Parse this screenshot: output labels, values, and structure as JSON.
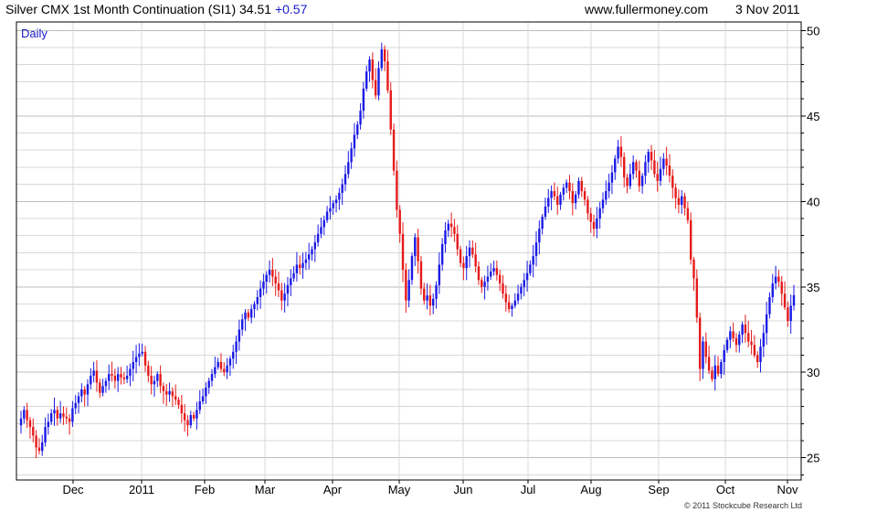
{
  "header": {
    "title": "Silver CMX 1st Month Continuation (SI1)",
    "last": "34.51",
    "change": "+0.57",
    "site": "www.fullermoney.com",
    "date": "3 Nov 2011"
  },
  "copyright": "© 2011 Stockcube Research Ltd",
  "chart_data": {
    "type": "candlestick",
    "period_label": "Daily",
    "x_tick_labels": [
      "Dec",
      "2011",
      "Feb",
      "Mar",
      "Apr",
      "May",
      "Jun",
      "Jul",
      "Aug",
      "Sep",
      "Oct",
      "Nov"
    ],
    "y_ticks": [
      25,
      30,
      35,
      40,
      45,
      50
    ],
    "ylim": [
      23.7,
      50.5
    ],
    "y_axis_side": "right",
    "grid": true,
    "colors": {
      "up": "#1a1ae6",
      "down": "#e61a1a",
      "grid": "#d8d8d8",
      "frame": "#000000",
      "label": "#1a1ac8"
    },
    "series_close": [
      27.3,
      27.8,
      27.2,
      26.8,
      26.3,
      25.6,
      25.4,
      25.9,
      26.8,
      27.1,
      27.6,
      27.8,
      27.3,
      27.6,
      27.4,
      27.3,
      27.1,
      27.9,
      28.2,
      28.6,
      29.0,
      28.7,
      29.3,
      29.8,
      30.1,
      29.4,
      28.8,
      29.2,
      29.5,
      29.9,
      29.8,
      29.5,
      29.9,
      29.7,
      29.6,
      29.8,
      30.2,
      30.6,
      30.9,
      31.1,
      31.2,
      30.4,
      29.8,
      29.3,
      29.5,
      29.9,
      29.2,
      28.9,
      28.7,
      28.9,
      28.6,
      28.4,
      28.1,
      27.6,
      27.2,
      26.9,
      27.5,
      27.3,
      27.8,
      28.3,
      28.6,
      29.1,
      29.5,
      29.9,
      30.3,
      30.6,
      30.2,
      30.0,
      30.4,
      30.8,
      31.2,
      31.8,
      32.5,
      33.1,
      33.5,
      33.2,
      33.7,
      34.0,
      34.4,
      34.9,
      35.3,
      35.7,
      36.0,
      35.6,
      35.2,
      34.8,
      34.2,
      34.6,
      35.1,
      35.5,
      35.8,
      36.3,
      36.1,
      36.4,
      36.6,
      36.9,
      37.2,
      37.6,
      38.1,
      38.5,
      38.9,
      39.4,
      39.6,
      39.9,
      40.1,
      40.5,
      41.0,
      41.6,
      42.3,
      43.1,
      43.9,
      44.5,
      45.3,
      46.6,
      47.6,
      48.3,
      47.1,
      46.2,
      47.8,
      48.9,
      48.2,
      46.5,
      44.2,
      41.8,
      39.5,
      38.1,
      36.0,
      34.2,
      35.4,
      36.8,
      37.9,
      36.5,
      34.9,
      34.2,
      34.5,
      33.9,
      34.3,
      35.1,
      36.3,
      37.5,
      38.3,
      38.7,
      38.5,
      38.1,
      37.2,
      36.4,
      36.1,
      36.8,
      37.3,
      36.9,
      36.2,
      35.4,
      35.0,
      35.3,
      35.6,
      35.9,
      36.1,
      35.7,
      35.2,
      34.6,
      34.1,
      33.7,
      33.9,
      34.2,
      34.6,
      35.0,
      35.4,
      35.8,
      36.3,
      36.8,
      37.6,
      38.4,
      39.1,
      39.7,
      40.2,
      40.6,
      40.3,
      39.8,
      40.4,
      40.8,
      41.1,
      40.6,
      39.9,
      40.4,
      41.2,
      40.6,
      40.1,
      39.3,
      38.8,
      38.4,
      39.0,
      39.6,
      40.1,
      40.6,
      41.1,
      41.7,
      42.5,
      43.2,
      42.6,
      41.4,
      40.9,
      41.6,
      42.3,
      41.8,
      40.9,
      41.5,
      42.3,
      42.9,
      42.4,
      41.6,
      41.2,
      41.9,
      42.5,
      42.1,
      41.5,
      40.8,
      40.2,
      39.8,
      40.3,
      39.6,
      38.9,
      36.6,
      35.5,
      33.2,
      30.2,
      31.8,
      30.9,
      30.1,
      29.6,
      30.4,
      29.9,
      30.6,
      31.3,
      31.9,
      32.4,
      32.0,
      31.6,
      32.2,
      32.8,
      32.3,
      31.8,
      31.6,
      31.0,
      30.6,
      31.5,
      32.3,
      33.4,
      34.4,
      35.2,
      35.6,
      35.3,
      34.6,
      33.8,
      33.0,
      33.9,
      34.51
    ]
  }
}
